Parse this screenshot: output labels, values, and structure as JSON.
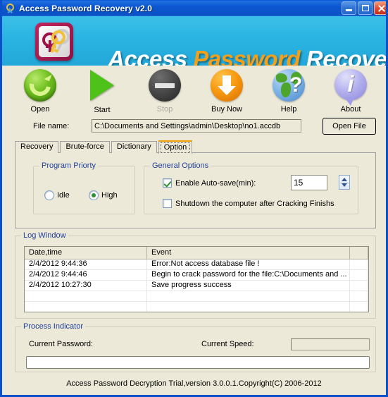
{
  "window": {
    "title": "Access Password Recovery v2.0",
    "icon": "key-icon",
    "controls": {
      "minimize": "minimize-button",
      "maximize": "maximize-button",
      "close": "close-button"
    }
  },
  "banner": {
    "logo": "access-key-logo",
    "word1": "Access",
    "word2": "Password",
    "word3": "Recovery",
    "accent_color": "#f2a01c",
    "bg_color": "#2ab4e2"
  },
  "toolbar": {
    "buttons": [
      {
        "label": "Open",
        "icon": "refresh-circle-icon",
        "enabled": true
      },
      {
        "label": "Start",
        "icon": "play-triangle-icon",
        "enabled": true
      },
      {
        "label": "Stop",
        "icon": "stop-minus-icon",
        "enabled": false
      },
      {
        "label": "Buy Now",
        "icon": "download-arrow-icon",
        "enabled": true
      },
      {
        "label": "Help",
        "icon": "globe-question-icon",
        "enabled": true
      },
      {
        "label": "About",
        "icon": "info-bubble-icon",
        "enabled": true
      }
    ]
  },
  "file_row": {
    "label": "File name:",
    "value": "C:\\Documents and Settings\\admin\\Desktop\\no1.accdb",
    "placeholder": "",
    "button": "Open File"
  },
  "tabs": [
    {
      "label": "Recovery",
      "active": false
    },
    {
      "label": "Brute-force",
      "active": false
    },
    {
      "label": "Dictionary",
      "active": false
    },
    {
      "label": "Option",
      "active": true
    }
  ],
  "option_tab": {
    "priority_group": {
      "title": "Program Priorty",
      "options": [
        {
          "label": "Idle",
          "checked": false
        },
        {
          "label": "High",
          "checked": true
        }
      ]
    },
    "general_group": {
      "title": "General Options",
      "autosave": {
        "label": "Enable Auto-save(min):",
        "checked": true,
        "value": "15"
      },
      "shutdown": {
        "label": "Shutdown the computer after Cracking Finishs",
        "checked": false
      }
    }
  },
  "log_window": {
    "title": "Log Window",
    "columns": [
      "Date,time",
      "Event",
      ""
    ],
    "rows": [
      [
        "2/4/2012 9:44:36",
        "Error:Not access database file !",
        ""
      ],
      [
        "2/4/2012 9:44:46",
        "Begin to crack password for the file:C:\\Documents and ...",
        ""
      ],
      [
        "2/4/2012 10:27:30",
        "Save progress success",
        ""
      ],
      [
        "",
        "",
        ""
      ],
      [
        "",
        "",
        ""
      ],
      [
        "",
        "",
        ""
      ]
    ]
  },
  "process_indicator": {
    "title": "Process Indicator",
    "current_password_label": "Current Password:",
    "current_password_value": "",
    "current_speed_label": "Current Speed:",
    "current_speed_value": "",
    "progress_value": ""
  },
  "status_bar": {
    "text": "Access Password Decryption Trial,version 3.0.0.1.Copyright(C) 2006-2012"
  }
}
